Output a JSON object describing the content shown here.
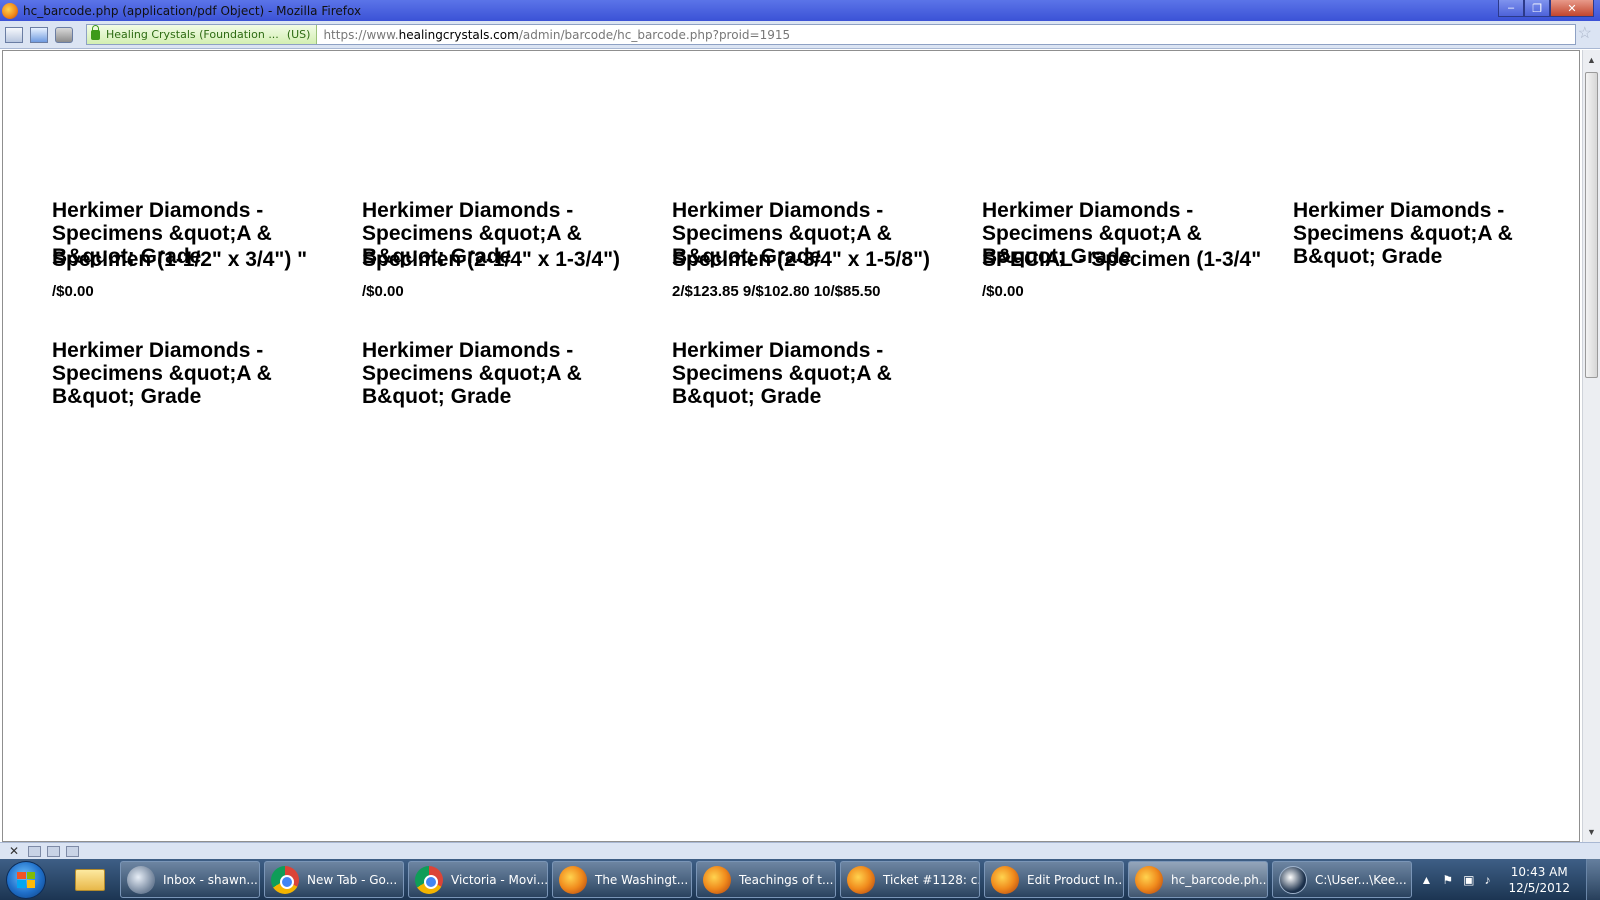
{
  "window": {
    "title": "hc_barcode.php (application/pdf Object) - Mozilla Firefox",
    "minimize": "–",
    "maximize": "❐",
    "close": "✕"
  },
  "addressbar": {
    "site_identity": "Healing Crystals (Foundation ...",
    "site_country": "(US)",
    "url_prefix": "https://www.",
    "url_domain": "healingcrystals.com",
    "url_path": "/admin/barcode/hc_barcode.php?proid=1915"
  },
  "labels": [
    {
      "name": "Herkimer Diamonds - Specimens &quot;A & B&quot; Grade",
      "spec": "Specimen (1-1/2\" x 3/4\") \"",
      "price": "/$0.00"
    },
    {
      "name": "Herkimer Diamonds - Specimens &quot;A & B&quot; Grade",
      "spec": "Specimen (2-1/4\" x 1-3/4\")",
      "price": "/$0.00"
    },
    {
      "name": "Herkimer Diamonds - Specimens &quot;A & B&quot; Grade",
      "spec": "Specimen (2-3/4\" x 1-5/8\")",
      "price": "2/$123.85 9/$102.80 10/$85.50"
    },
    {
      "name": "Herkimer Diamonds - Specimens &quot;A & B&quot; Grade",
      "spec": "SPECIAL - Specimen (1-3/4\"",
      "price": "/$0.00"
    },
    {
      "name": "Herkimer Diamonds - Specimens &quot;A & B&quot; Grade",
      "spec": "",
      "price": ""
    },
    {
      "name": "Herkimer Diamonds - Specimens &quot;A & B&quot; Grade",
      "spec": "",
      "price": ""
    },
    {
      "name": "Herkimer Diamonds - Specimens &quot;A & B&quot; Grade",
      "spec": "",
      "price": ""
    },
    {
      "name": "Herkimer Diamonds - Specimens &quot;A & B&quot; Grade",
      "spec": "",
      "price": ""
    }
  ],
  "taskbar": {
    "tasks": [
      {
        "label": "Inbox - shawn...",
        "icon": "thunderbird-icon"
      },
      {
        "label": "New Tab - Go...",
        "icon": "chrome-icon"
      },
      {
        "label": "Victoria - Movi...",
        "icon": "chrome-icon"
      },
      {
        "label": "The Washingt...",
        "icon": "firefox-icon"
      },
      {
        "label": "Teachings of t...",
        "icon": "firefox-icon"
      },
      {
        "label": "Ticket #1128: c...",
        "icon": "firefox-icon"
      },
      {
        "label": "Edit Product In...",
        "icon": "firefox-icon"
      },
      {
        "label": "hc_barcode.ph...",
        "icon": "firefox-icon"
      },
      {
        "label": "C:\\User...\\Kee...",
        "icon": "keepass-icon"
      }
    ],
    "clock_time": "10:43 AM",
    "clock_date": "12/5/2012"
  }
}
